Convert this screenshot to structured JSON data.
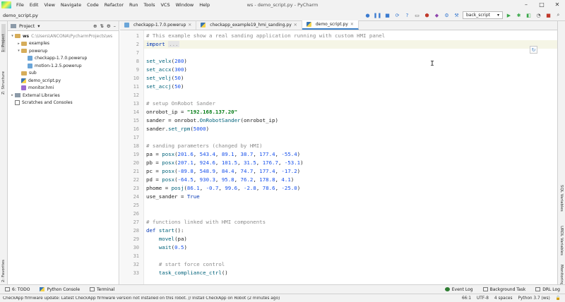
{
  "window": {
    "title": "ws - demo_script.py - PyCharm",
    "controls": [
      "–",
      "□",
      "✕"
    ]
  },
  "menu": [
    "File",
    "Edit",
    "View",
    "Navigate",
    "Code",
    "Refactor",
    "Run",
    "Tools",
    "VCS",
    "Window",
    "Help"
  ],
  "navbar": {
    "breadcrumb": "demo_script.py",
    "run_config": "back_script"
  },
  "left_strip": {
    "project": "1: Project",
    "structure": "Z: Structure",
    "favorites": "2: Favorites"
  },
  "right_strip": {
    "sql": "SQL Variables",
    "urdl": "URDL Variables",
    "monitoring": "Monitoring"
  },
  "project_panel": {
    "title": "Project",
    "tree": [
      {
        "depth": 0,
        "arrow": "▾",
        "icon": "folder",
        "label": "ws",
        "path": "C:\\Users\\ANCONA\\PycharmProjects\\ws",
        "bold": true
      },
      {
        "depth": 1,
        "arrow": "▸",
        "icon": "folder",
        "label": "examples"
      },
      {
        "depth": 1,
        "arrow": "▾",
        "icon": "folder",
        "label": "powerup"
      },
      {
        "depth": 2,
        "arrow": "",
        "icon": "powerup",
        "label": "checkapp-1.7.0.powerup"
      },
      {
        "depth": 2,
        "arrow": "",
        "icon": "powerup",
        "label": "motion-1.2.5.powerup"
      },
      {
        "depth": 1,
        "arrow": "",
        "icon": "folder",
        "label": "sub"
      },
      {
        "depth": 1,
        "arrow": "",
        "icon": "python",
        "label": "demo_script.py"
      },
      {
        "depth": 1,
        "arrow": "",
        "icon": "hmi",
        "label": "monitor.hmi"
      },
      {
        "depth": 0,
        "arrow": "▸",
        "icon": "library",
        "label": "External Libraries"
      },
      {
        "depth": 0,
        "arrow": "",
        "icon": "scratch",
        "label": "Scratches and Consoles"
      }
    ]
  },
  "tabs": [
    {
      "label": "checkapp-1.7.0.powerup",
      "active": false
    },
    {
      "label": "checkapp_example19_hmi_sanding.py",
      "active": false
    },
    {
      "label": "demo_script.py",
      "active": true
    }
  ],
  "editor": {
    "line_numbers": [
      "1",
      "2",
      "7",
      "8",
      "9",
      "10",
      "11",
      "12",
      "13",
      "14",
      "15",
      "16",
      "17",
      "18",
      "19",
      "20",
      "21",
      "22",
      "23",
      "24",
      "25",
      "26",
      "27",
      "28",
      "29",
      "30",
      "31",
      "32",
      "33"
    ],
    "lines": [
      [
        [
          "cm",
          "# This example show a real sanding application running with custom HMI panel"
        ]
      ],
      [
        [
          "kw",
          "import"
        ],
        [
          "id",
          " "
        ],
        [
          "fold",
          "..."
        ]
      ],
      [],
      [
        [
          "fn",
          "set_velx"
        ],
        [
          "id",
          "("
        ],
        [
          "num",
          "280"
        ],
        [
          "id",
          ")"
        ]
      ],
      [
        [
          "fn",
          "set_accx"
        ],
        [
          "id",
          "("
        ],
        [
          "num",
          "300"
        ],
        [
          "id",
          ")"
        ]
      ],
      [
        [
          "fn",
          "set_velj"
        ],
        [
          "id",
          "("
        ],
        [
          "num",
          "50"
        ],
        [
          "id",
          ")"
        ]
      ],
      [
        [
          "fn",
          "set_accj"
        ],
        [
          "id",
          "("
        ],
        [
          "num",
          "50"
        ],
        [
          "id",
          ")"
        ]
      ],
      [],
      [
        [
          "cm",
          "# setup OnRobot Sander"
        ]
      ],
      [
        [
          "id",
          "onrobot_ip = "
        ],
        [
          "str",
          "\"192.168.137.20\""
        ]
      ],
      [
        [
          "id",
          "sander = onrobot."
        ],
        [
          "fn",
          "OnRobotSander"
        ],
        [
          "id",
          "(onrobot_ip)"
        ]
      ],
      [
        [
          "id",
          "sander."
        ],
        [
          "fn",
          "set_rpm"
        ],
        [
          "id",
          "("
        ],
        [
          "num",
          "5000"
        ],
        [
          "id",
          ")"
        ]
      ],
      [],
      [
        [
          "cm",
          "# sanding parameters (changed by HMI)"
        ]
      ],
      [
        [
          "id",
          "pa = "
        ],
        [
          "fn",
          "posx"
        ],
        [
          "id",
          "("
        ],
        [
          "num",
          "201.6"
        ],
        [
          "id",
          ", "
        ],
        [
          "num",
          "543.4"
        ],
        [
          "id",
          ", "
        ],
        [
          "num",
          "89.1"
        ],
        [
          "id",
          ", "
        ],
        [
          "num",
          "38.7"
        ],
        [
          "id",
          ", "
        ],
        [
          "num",
          "177.4"
        ],
        [
          "id",
          ", "
        ],
        [
          "num",
          "-55.4"
        ],
        [
          "id",
          ")"
        ]
      ],
      [
        [
          "id",
          "pb = "
        ],
        [
          "fn",
          "posx"
        ],
        [
          "id",
          "("
        ],
        [
          "num",
          "207.1"
        ],
        [
          "id",
          ", "
        ],
        [
          "num",
          "924.6"
        ],
        [
          "id",
          ", "
        ],
        [
          "num",
          "101.5"
        ],
        [
          "id",
          ", "
        ],
        [
          "num",
          "31.5"
        ],
        [
          "id",
          ", "
        ],
        [
          "num",
          "176.7"
        ],
        [
          "id",
          ", "
        ],
        [
          "num",
          "-53.1"
        ],
        [
          "id",
          ")"
        ]
      ],
      [
        [
          "id",
          "pc = "
        ],
        [
          "fn",
          "posx"
        ],
        [
          "id",
          "("
        ],
        [
          "num",
          "-89.8"
        ],
        [
          "id",
          ", "
        ],
        [
          "num",
          "548.9"
        ],
        [
          "id",
          ", "
        ],
        [
          "num",
          "84.4"
        ],
        [
          "id",
          ", "
        ],
        [
          "num",
          "74.7"
        ],
        [
          "id",
          ", "
        ],
        [
          "num",
          "177.4"
        ],
        [
          "id",
          ", "
        ],
        [
          "num",
          "-17.2"
        ],
        [
          "id",
          ")"
        ]
      ],
      [
        [
          "id",
          "pd = "
        ],
        [
          "fn",
          "posx"
        ],
        [
          "id",
          "("
        ],
        [
          "num",
          "-64.5"
        ],
        [
          "id",
          ", "
        ],
        [
          "num",
          "930.3"
        ],
        [
          "id",
          ", "
        ],
        [
          "num",
          "95.8"
        ],
        [
          "id",
          ", "
        ],
        [
          "num",
          "76.2"
        ],
        [
          "id",
          ", "
        ],
        [
          "num",
          "178.8"
        ],
        [
          "id",
          ", "
        ],
        [
          "num",
          "4.1"
        ],
        [
          "id",
          ")"
        ]
      ],
      [
        [
          "id",
          "phome = "
        ],
        [
          "fn",
          "posj"
        ],
        [
          "id",
          "("
        ],
        [
          "num",
          "86.1"
        ],
        [
          "id",
          ", "
        ],
        [
          "num",
          "-0.7"
        ],
        [
          "id",
          ", "
        ],
        [
          "num",
          "99.6"
        ],
        [
          "id",
          ", "
        ],
        [
          "num",
          "-2.8"
        ],
        [
          "id",
          ", "
        ],
        [
          "num",
          "78.6"
        ],
        [
          "id",
          ", "
        ],
        [
          "num",
          "-25.0"
        ],
        [
          "id",
          ")"
        ]
      ],
      [
        [
          "id",
          "use_sander = "
        ],
        [
          "kw",
          "True"
        ]
      ],
      [],
      [],
      [
        [
          "cm",
          "# functions linked with HMI components"
        ]
      ],
      [
        [
          "kw",
          "def "
        ],
        [
          "fn",
          "start"
        ],
        [
          "id",
          "():"
        ]
      ],
      [
        [
          "id",
          "    "
        ],
        [
          "fn",
          "movel"
        ],
        [
          "id",
          "(pa)"
        ]
      ],
      [
        [
          "id",
          "    "
        ],
        [
          "fn",
          "wait"
        ],
        [
          "id",
          "("
        ],
        [
          "num",
          "0.5"
        ],
        [
          "id",
          ")"
        ]
      ],
      [],
      [
        [
          "id",
          "    "
        ],
        [
          "cm",
          "# start force control"
        ]
      ],
      [
        [
          "id",
          "    "
        ],
        [
          "fn",
          "task_compliance_ctrl"
        ],
        [
          "id",
          "()"
        ]
      ]
    ]
  },
  "bottom_tools": {
    "todo": "6: TODO",
    "python_console": "Python Console",
    "terminal": "Terminal",
    "event_log": "Event Log",
    "background_task": "Background Task",
    "drl_log": "DRL Log"
  },
  "status": {
    "message": "CheckApp firmware update: Latest CheckApp firmware version not installed on this robot. // Install CheckApp on Robot (2 minutes ago)",
    "position": "66:1",
    "encoding": "UTF-8",
    "indent": "4 spaces",
    "interpreter": "Python 3.7 (ws)"
  }
}
